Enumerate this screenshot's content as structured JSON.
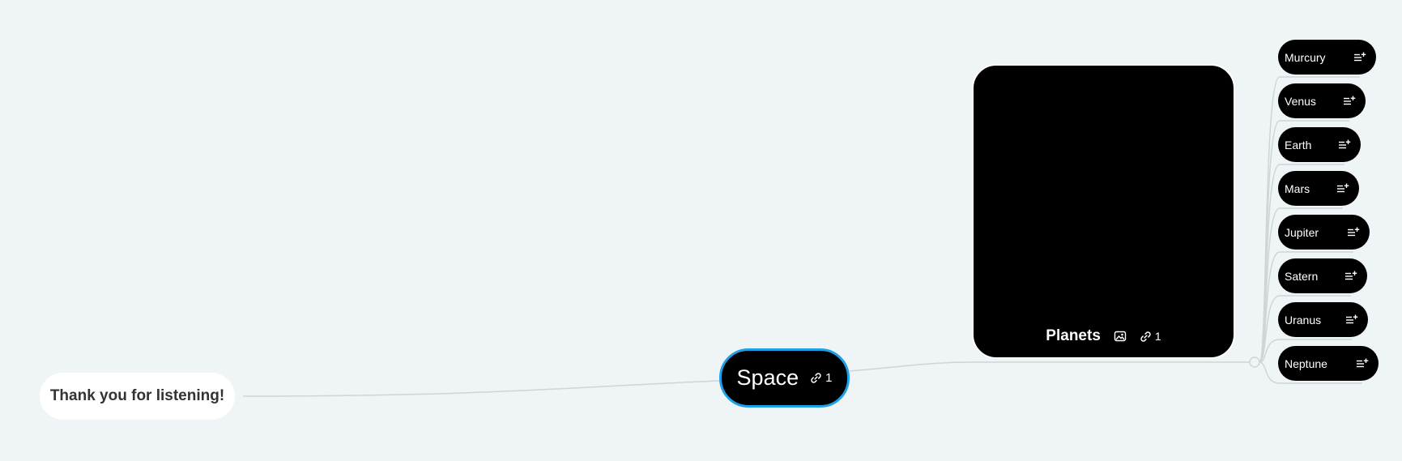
{
  "mindmap": {
    "left_node": {
      "label": "Thank you for listening!"
    },
    "central_node": {
      "label": "Space",
      "link_icon": "link-icon",
      "link_count": "1"
    },
    "planets_node": {
      "label": "Planets",
      "image_icon": "image-icon",
      "link_icon": "link-icon",
      "link_count": "1"
    },
    "planet_items": [
      {
        "label": "Murcury",
        "icon": "note-add-icon"
      },
      {
        "label": "Venus",
        "icon": "note-add-icon"
      },
      {
        "label": "Earth",
        "icon": "note-add-icon"
      },
      {
        "label": "Mars",
        "icon": "note-add-icon"
      },
      {
        "label": "Jupiter",
        "icon": "note-add-icon"
      },
      {
        "label": "Satern",
        "icon": "note-add-icon"
      },
      {
        "label": "Uranus",
        "icon": "note-add-icon"
      },
      {
        "label": "Neptune",
        "icon": "note-add-icon"
      }
    ]
  },
  "colors": {
    "canvas_background": "#eff4f6",
    "node_fill": "#000000",
    "selected_outline": "#1ea0e6",
    "connector": "#cfd4d7"
  }
}
